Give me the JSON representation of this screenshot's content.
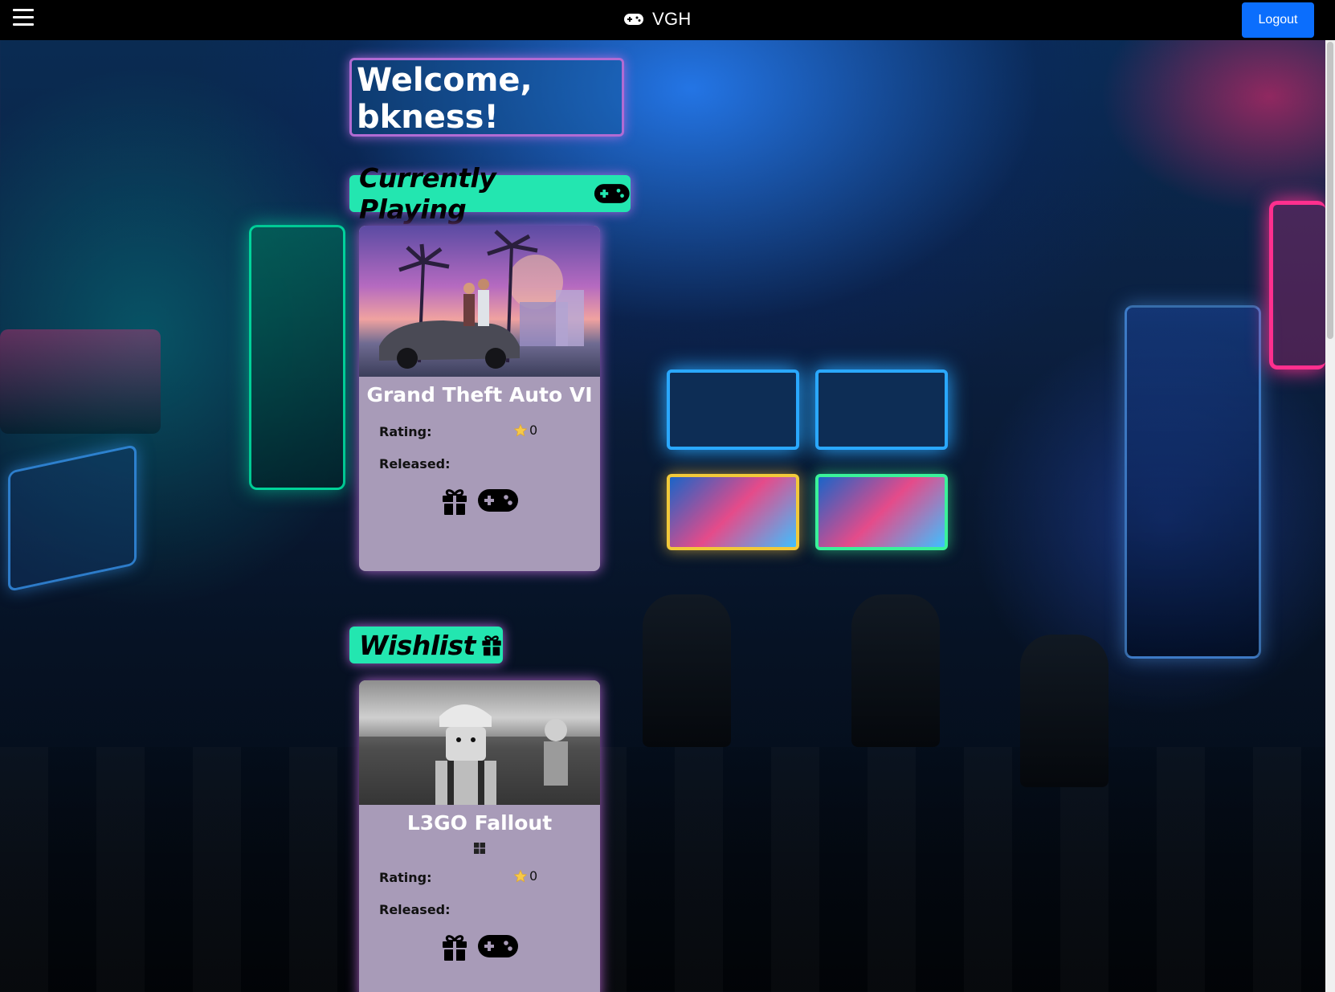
{
  "navbar": {
    "brand": "VGH",
    "logout_label": "Logout"
  },
  "welcome": {
    "text": "Welcome, bkness!"
  },
  "sections": {
    "currently_playing": "Currently Playing",
    "wishlist": "Wishlist"
  },
  "cards": [
    {
      "title": "Grand Theft Auto VI",
      "rating_label": "Rating:",
      "rating_value": "0",
      "released_label": "Released:",
      "released_value": ""
    },
    {
      "title": "L3GO Fallout",
      "platform_icon": "windows-icon",
      "rating_label": "Rating:",
      "rating_value": "0",
      "released_label": "Released:",
      "released_value": ""
    }
  ],
  "colors": {
    "navbar": "#000000",
    "logout_button": "#0b6efd",
    "section_title": "#23e6b0",
    "card": "#a89bb8",
    "glow": "#b16bd3"
  }
}
